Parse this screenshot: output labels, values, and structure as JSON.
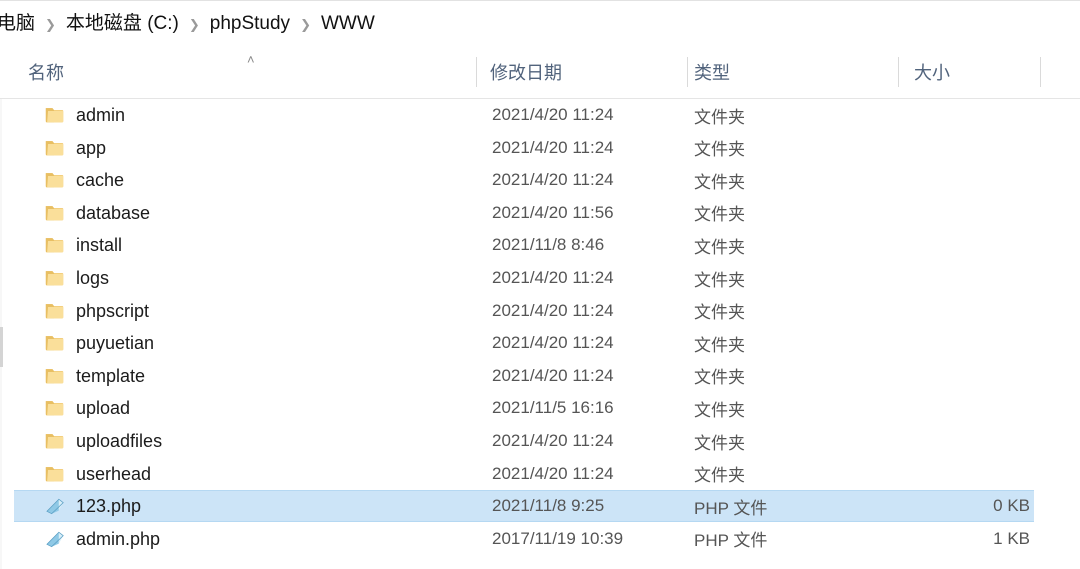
{
  "window": {
    "title": "WWW"
  },
  "breadcrumb": {
    "name": "address-breadcrumb",
    "separator": "❯",
    "items": [
      {
        "label": "电脑"
      },
      {
        "label": "本地磁盘 (C:)"
      },
      {
        "label": "phpStudy"
      },
      {
        "label": "WWW"
      }
    ]
  },
  "columns": {
    "sort_caret": "˄",
    "headers": [
      {
        "key": "name",
        "label": "名称"
      },
      {
        "key": "date",
        "label": "修改日期"
      },
      {
        "key": "type",
        "label": "类型"
      },
      {
        "key": "size",
        "label": "大小"
      }
    ]
  },
  "colors": {
    "selection": "#cce4f7",
    "selection_border": "#b5d8f2",
    "header_text": "#51637c",
    "row_text": "#1b1b1b",
    "meta_text": "#555555",
    "folder_icon": "#f6d78d",
    "php_icon": "#9fd3ea"
  },
  "files": [
    {
      "icon": "folder-icon",
      "name": "admin",
      "date": "2021/4/20 11:24",
      "type": "文件夹",
      "size": "",
      "selected": false
    },
    {
      "icon": "folder-icon",
      "name": "app",
      "date": "2021/4/20 11:24",
      "type": "文件夹",
      "size": "",
      "selected": false
    },
    {
      "icon": "folder-icon",
      "name": "cache",
      "date": "2021/4/20 11:24",
      "type": "文件夹",
      "size": "",
      "selected": false
    },
    {
      "icon": "folder-icon",
      "name": "database",
      "date": "2021/4/20 11:56",
      "type": "文件夹",
      "size": "",
      "selected": false
    },
    {
      "icon": "folder-icon",
      "name": "install",
      "date": "2021/11/8 8:46",
      "type": "文件夹",
      "size": "",
      "selected": false
    },
    {
      "icon": "folder-icon",
      "name": "logs",
      "date": "2021/4/20 11:24",
      "type": "文件夹",
      "size": "",
      "selected": false
    },
    {
      "icon": "folder-icon",
      "name": "phpscript",
      "date": "2021/4/20 11:24",
      "type": "文件夹",
      "size": "",
      "selected": false
    },
    {
      "icon": "folder-icon",
      "name": "puyuetian",
      "date": "2021/4/20 11:24",
      "type": "文件夹",
      "size": "",
      "selected": false
    },
    {
      "icon": "folder-icon",
      "name": "template",
      "date": "2021/4/20 11:24",
      "type": "文件夹",
      "size": "",
      "selected": false
    },
    {
      "icon": "folder-icon",
      "name": "upload",
      "date": "2021/11/5 16:16",
      "type": "文件夹",
      "size": "",
      "selected": false
    },
    {
      "icon": "folder-icon",
      "name": "uploadfiles",
      "date": "2021/4/20 11:24",
      "type": "文件夹",
      "size": "",
      "selected": false
    },
    {
      "icon": "folder-icon",
      "name": "userhead",
      "date": "2021/4/20 11:24",
      "type": "文件夹",
      "size": "",
      "selected": false
    },
    {
      "icon": "php-file-icon",
      "name": "123.php",
      "date": "2021/11/8 9:25",
      "type": "PHP 文件",
      "size": "0 KB",
      "selected": true
    },
    {
      "icon": "php-file-icon",
      "name": "admin.php",
      "date": "2017/11/19 10:39",
      "type": "PHP 文件",
      "size": "1 KB",
      "selected": false
    }
  ]
}
